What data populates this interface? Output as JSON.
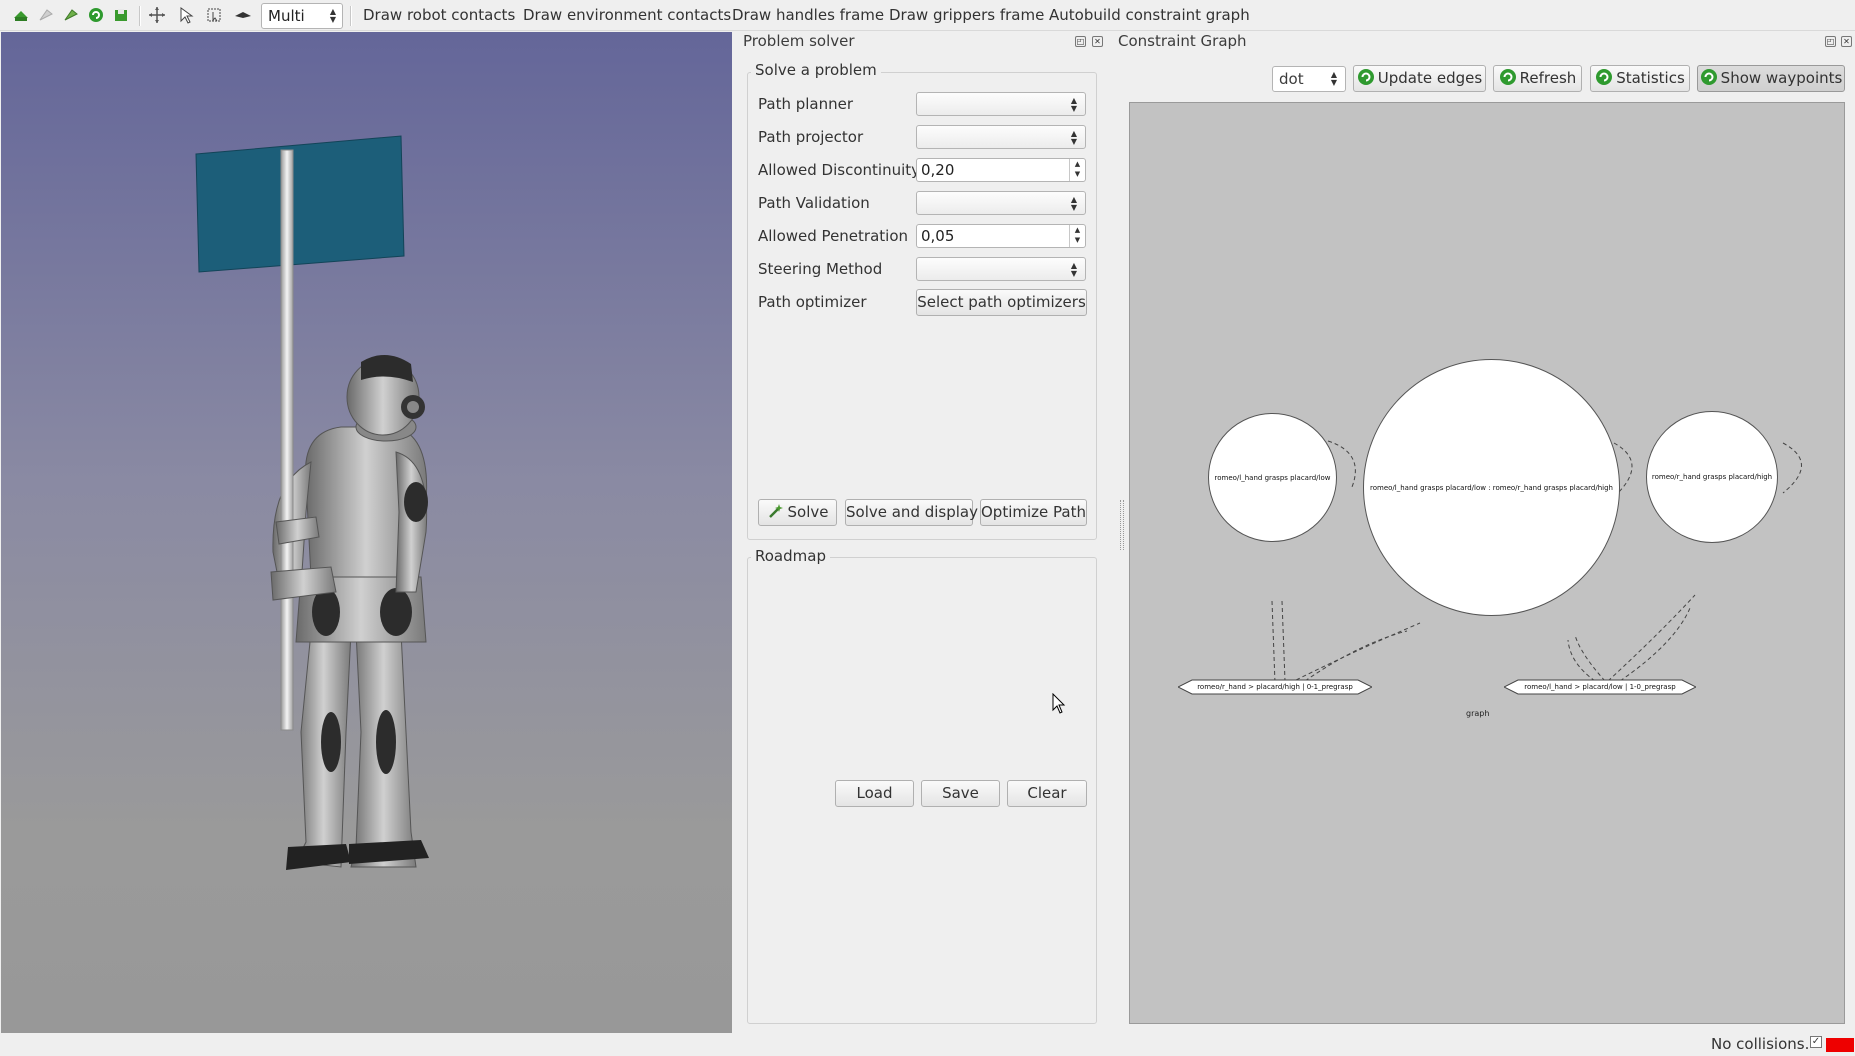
{
  "toolbar": {
    "mode_select": "Multi",
    "actions": [
      "Draw robot contacts",
      "Draw environment contacts",
      "Draw handles frame",
      "Draw grippers frame",
      "Autobuild constraint graph"
    ]
  },
  "problem_solver": {
    "title": "Problem solver",
    "group_title": "Solve a problem",
    "path_planner_label": "Path planner",
    "path_planner_value": "",
    "path_projector_label": "Path projector",
    "path_projector_value": "",
    "allowed_discontinuity_label": "Allowed Discontinuity",
    "allowed_discontinuity_value": "0,20",
    "path_validation_label": "Path Validation",
    "path_validation_value": "",
    "allowed_penetration_label": "Allowed Penetration",
    "allowed_penetration_value": "0,05",
    "steering_method_label": "Steering Method",
    "steering_method_value": "",
    "path_optimizer_label": "Path optimizer",
    "select_optimizers_button": "Select path optimizers",
    "solve_button": "Solve",
    "solve_display_button": "Solve and display",
    "optimize_path_button": "Optimize Path",
    "roadmap_title": "Roadmap",
    "load_button": "Load",
    "save_button": "Save",
    "clear_button": "Clear"
  },
  "constraint_graph": {
    "title": "Constraint Graph",
    "layout_select": "dot",
    "update_edges_button": "Update edges",
    "refresh_button": "Refresh",
    "statistics_button": "Statistics",
    "show_waypoints_button": "Show waypoints",
    "nodes": [
      "romeo/l_hand grasps placard/low",
      "romeo/l_hand grasps placard/low : romeo/r_hand grasps placard/high",
      "romeo/r_hand grasps placard/high"
    ],
    "waypoints": [
      "romeo/r_hand > placard/high | 0-1_pregrasp",
      "romeo/l_hand > placard/low | 1-0_pregrasp"
    ],
    "graph_label": "graph"
  },
  "status": {
    "text": "No collisions.",
    "indicator_color": "#ee0000"
  },
  "colors": {
    "viewer_top": "#646699",
    "viewer_bottom": "#989898",
    "placard": "#1c5e79",
    "graph_bg": "#c2c2c2"
  }
}
